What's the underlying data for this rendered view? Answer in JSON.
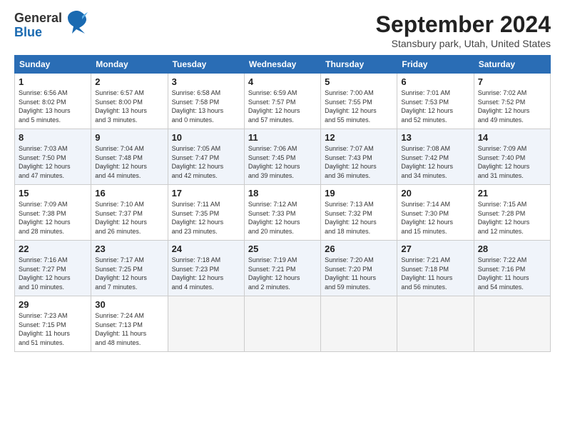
{
  "logo": {
    "line1": "General",
    "line2": "Blue"
  },
  "title": "September 2024",
  "subtitle": "Stansbury park, Utah, United States",
  "weekdays": [
    "Sunday",
    "Monday",
    "Tuesday",
    "Wednesday",
    "Thursday",
    "Friday",
    "Saturday"
  ],
  "weeks": [
    [
      {
        "day": "1",
        "info": "Sunrise: 6:56 AM\nSunset: 8:02 PM\nDaylight: 13 hours\nand 5 minutes."
      },
      {
        "day": "2",
        "info": "Sunrise: 6:57 AM\nSunset: 8:00 PM\nDaylight: 13 hours\nand 3 minutes."
      },
      {
        "day": "3",
        "info": "Sunrise: 6:58 AM\nSunset: 7:58 PM\nDaylight: 13 hours\nand 0 minutes."
      },
      {
        "day": "4",
        "info": "Sunrise: 6:59 AM\nSunset: 7:57 PM\nDaylight: 12 hours\nand 57 minutes."
      },
      {
        "day": "5",
        "info": "Sunrise: 7:00 AM\nSunset: 7:55 PM\nDaylight: 12 hours\nand 55 minutes."
      },
      {
        "day": "6",
        "info": "Sunrise: 7:01 AM\nSunset: 7:53 PM\nDaylight: 12 hours\nand 52 minutes."
      },
      {
        "day": "7",
        "info": "Sunrise: 7:02 AM\nSunset: 7:52 PM\nDaylight: 12 hours\nand 49 minutes."
      }
    ],
    [
      {
        "day": "8",
        "info": "Sunrise: 7:03 AM\nSunset: 7:50 PM\nDaylight: 12 hours\nand 47 minutes."
      },
      {
        "day": "9",
        "info": "Sunrise: 7:04 AM\nSunset: 7:48 PM\nDaylight: 12 hours\nand 44 minutes."
      },
      {
        "day": "10",
        "info": "Sunrise: 7:05 AM\nSunset: 7:47 PM\nDaylight: 12 hours\nand 42 minutes."
      },
      {
        "day": "11",
        "info": "Sunrise: 7:06 AM\nSunset: 7:45 PM\nDaylight: 12 hours\nand 39 minutes."
      },
      {
        "day": "12",
        "info": "Sunrise: 7:07 AM\nSunset: 7:43 PM\nDaylight: 12 hours\nand 36 minutes."
      },
      {
        "day": "13",
        "info": "Sunrise: 7:08 AM\nSunset: 7:42 PM\nDaylight: 12 hours\nand 34 minutes."
      },
      {
        "day": "14",
        "info": "Sunrise: 7:09 AM\nSunset: 7:40 PM\nDaylight: 12 hours\nand 31 minutes."
      }
    ],
    [
      {
        "day": "15",
        "info": "Sunrise: 7:09 AM\nSunset: 7:38 PM\nDaylight: 12 hours\nand 28 minutes."
      },
      {
        "day": "16",
        "info": "Sunrise: 7:10 AM\nSunset: 7:37 PM\nDaylight: 12 hours\nand 26 minutes."
      },
      {
        "day": "17",
        "info": "Sunrise: 7:11 AM\nSunset: 7:35 PM\nDaylight: 12 hours\nand 23 minutes."
      },
      {
        "day": "18",
        "info": "Sunrise: 7:12 AM\nSunset: 7:33 PM\nDaylight: 12 hours\nand 20 minutes."
      },
      {
        "day": "19",
        "info": "Sunrise: 7:13 AM\nSunset: 7:32 PM\nDaylight: 12 hours\nand 18 minutes."
      },
      {
        "day": "20",
        "info": "Sunrise: 7:14 AM\nSunset: 7:30 PM\nDaylight: 12 hours\nand 15 minutes."
      },
      {
        "day": "21",
        "info": "Sunrise: 7:15 AM\nSunset: 7:28 PM\nDaylight: 12 hours\nand 12 minutes."
      }
    ],
    [
      {
        "day": "22",
        "info": "Sunrise: 7:16 AM\nSunset: 7:27 PM\nDaylight: 12 hours\nand 10 minutes."
      },
      {
        "day": "23",
        "info": "Sunrise: 7:17 AM\nSunset: 7:25 PM\nDaylight: 12 hours\nand 7 minutes."
      },
      {
        "day": "24",
        "info": "Sunrise: 7:18 AM\nSunset: 7:23 PM\nDaylight: 12 hours\nand 4 minutes."
      },
      {
        "day": "25",
        "info": "Sunrise: 7:19 AM\nSunset: 7:21 PM\nDaylight: 12 hours\nand 2 minutes."
      },
      {
        "day": "26",
        "info": "Sunrise: 7:20 AM\nSunset: 7:20 PM\nDaylight: 11 hours\nand 59 minutes."
      },
      {
        "day": "27",
        "info": "Sunrise: 7:21 AM\nSunset: 7:18 PM\nDaylight: 11 hours\nand 56 minutes."
      },
      {
        "day": "28",
        "info": "Sunrise: 7:22 AM\nSunset: 7:16 PM\nDaylight: 11 hours\nand 54 minutes."
      }
    ],
    [
      {
        "day": "29",
        "info": "Sunrise: 7:23 AM\nSunset: 7:15 PM\nDaylight: 11 hours\nand 51 minutes."
      },
      {
        "day": "30",
        "info": "Sunrise: 7:24 AM\nSunset: 7:13 PM\nDaylight: 11 hours\nand 48 minutes."
      },
      null,
      null,
      null,
      null,
      null
    ]
  ]
}
